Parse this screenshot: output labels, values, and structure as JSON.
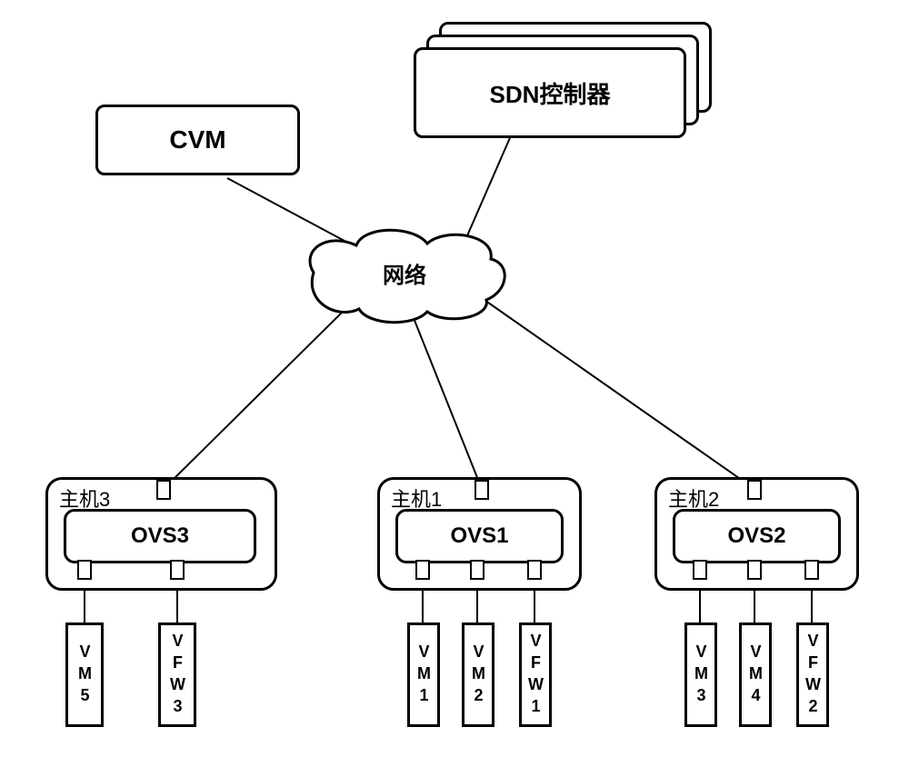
{
  "cvm": {
    "label": "CVM"
  },
  "sdn": {
    "label": "SDN控制器"
  },
  "network": {
    "label": "网络"
  },
  "hosts": {
    "host3": {
      "label": "主机3",
      "ovs": "OVS3",
      "leaves": {
        "vm5": "VM5",
        "vfw3": "VFW3"
      }
    },
    "host1": {
      "label": "主机1",
      "ovs": "OVS1",
      "leaves": {
        "vm1": "VM1",
        "vm2": "VM2",
        "vfw1": "VFW1"
      }
    },
    "host2": {
      "label": "主机2",
      "ovs": "OVS2",
      "leaves": {
        "vm3": "VM3",
        "vm4": "VM4",
        "vfw2": "VFW2"
      }
    }
  }
}
